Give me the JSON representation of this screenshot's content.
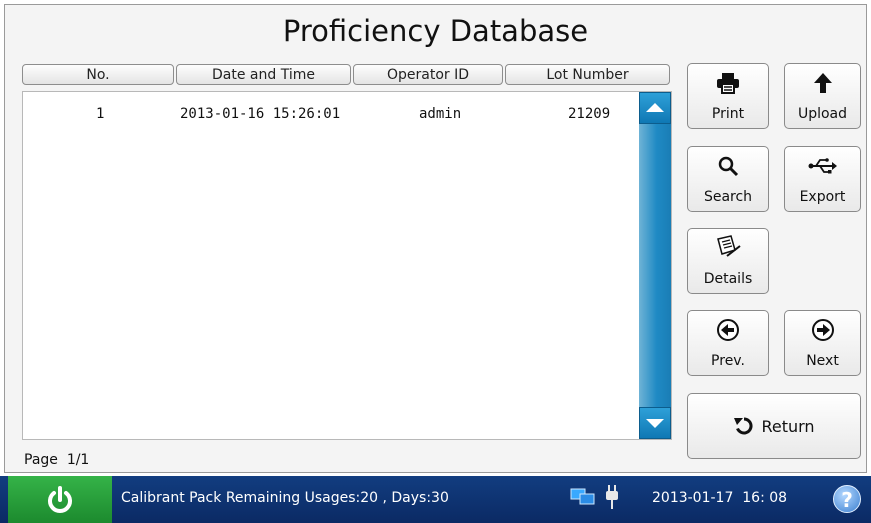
{
  "title": "Proficiency Database",
  "table": {
    "headers": [
      "No.",
      "Date and Time",
      "Operator ID",
      "Lot Number"
    ],
    "rows": [
      {
        "no": "1",
        "datetime": "2013-01-16 15:26:01",
        "operator": "admin",
        "lot": "21209"
      }
    ]
  },
  "page": {
    "label": "Page",
    "value": "1/1"
  },
  "buttons": {
    "print": "Print",
    "upload": "Upload",
    "search": "Search",
    "export": "Export",
    "details": "Details",
    "prev": "Prev.",
    "next": "Next",
    "return": "Return"
  },
  "icons": {
    "print": "printer-icon",
    "upload": "arrow-up-icon",
    "search": "magnifier-icon",
    "export": "usb-icon",
    "details": "document-pen-icon",
    "prev": "circle-arrow-left-icon",
    "next": "circle-arrow-right-icon",
    "return": "undo-arrow-icon",
    "power": "power-icon",
    "network": "network-icon",
    "plug": "power-plug-icon",
    "help": "help-icon"
  },
  "status": {
    "message": "Calibrant Pack Remaining Usages:20 , Days:30",
    "datetime": "2013-01-17  16: 08",
    "help_glyph": "?"
  },
  "colors": {
    "status_bar": "#0b2a64",
    "power_button": "#2ca23f",
    "scrollbar": "#1f8ac4"
  }
}
